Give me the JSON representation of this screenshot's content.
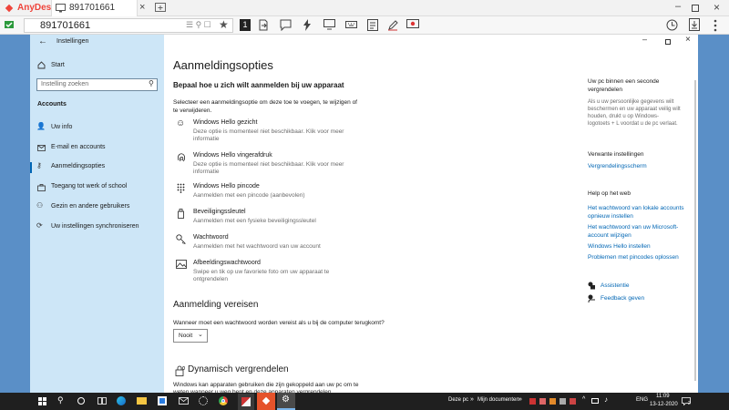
{
  "anydesk": {
    "app_name": "AnyDesk",
    "tab_id": "891701661",
    "address_value": "891701661",
    "monitor_number": "1",
    "colors": {
      "brand": "#ef443b"
    }
  },
  "window": {
    "title": "Instellingen"
  },
  "sidebar": {
    "home": "Start",
    "search_placeholder": "Instelling zoeken",
    "section_title": "Accounts",
    "items": [
      {
        "label": "Uw info",
        "icon": "person-icon"
      },
      {
        "label": "E-mail en accounts",
        "icon": "mail-icon"
      },
      {
        "label": "Aanmeldingsopties",
        "icon": "key-icon"
      },
      {
        "label": "Toegang tot werk of school",
        "icon": "briefcase-icon"
      },
      {
        "label": "Gezin en andere gebruikers",
        "icon": "people-icon"
      },
      {
        "label": "Uw instellingen synchroniseren",
        "icon": "sync-icon"
      }
    ]
  },
  "main": {
    "page_title": "Aanmeldingsopties",
    "subtitle": "Bepaal hoe u zich wilt aanmelden bij uw apparaat",
    "intro_line1": "Selecteer een aanmeldingsoptie om deze toe te voegen, te wijzigen of",
    "intro_line2": "te verwijderen.",
    "options": [
      {
        "title": "Windows Hello gezicht",
        "desc1": "Deze optie is momenteel niet beschikbaar. Klik voor meer",
        "desc2": "informatie"
      },
      {
        "title": "Windows Hello vingerafdruk",
        "desc1": "Deze optie is momenteel niet beschikbaar. Klik voor meer",
        "desc2": "informatie"
      },
      {
        "title": "Windows Hello pincode",
        "desc1": "Aanmelden met een pincode (aanbevolen)",
        "desc2": ""
      },
      {
        "title": "Beveiligingssleutel",
        "desc1": "Aanmelden met een fysieke beveiligingssleutel",
        "desc2": ""
      },
      {
        "title": "Wachtwoord",
        "desc1": "Aanmelden met het wachtwoord van uw account",
        "desc2": ""
      },
      {
        "title": "Afbeeldingswachtwoord",
        "desc1": "Swipe en tik op uw favoriete foto om uw apparaat te",
        "desc2": "ontgrendelen"
      }
    ],
    "require_heading": "Aanmelding vereisen",
    "require_question": "Wanneer moet een wachtwoord worden vereist als u bij de computer terugkomt?",
    "require_value": "Nooit",
    "dynamic_heading": "Dynamisch vergrendelen",
    "dynamic_line1": "Windows kan apparaten gebruiken die zijn gekoppeld aan uw pc om te",
    "dynamic_line2": "weten wanneer u weg bent en deze apparaten vergrendelen"
  },
  "right_panel": {
    "seconds_title1": "Uw pc binnen een seconde",
    "seconds_title2": "vergrendelen",
    "seconds_desc": [
      "Als u uw persoonlijke gegevens wilt",
      "beschermen en uw apparaat veilig wilt",
      "houden, drukt u op Windows-",
      "logotoets + L voordat u de pc verlaat."
    ],
    "related_title": "Verwante instellingen",
    "related_link": "Vergrendelingsscherm",
    "help_title": "Help op het web",
    "help_links": [
      "Het wachtwoord van lokale accounts",
      "opnieuw instellen",
      "Het wachtwoord van uw Microsoft-",
      "account wijzigen",
      "Windows Hello instellen",
      "Problemen met pincodes oplossen"
    ],
    "assist": "Assistentie",
    "feedback": "Feedback geven"
  },
  "taskbar": {
    "search_text": "",
    "deze_pc": "Deze pc",
    "mijn_documenten": "Mijn documenten",
    "lang": "ENG",
    "time": "11:09",
    "date": "13-12-2020",
    "notif_count": "2"
  }
}
